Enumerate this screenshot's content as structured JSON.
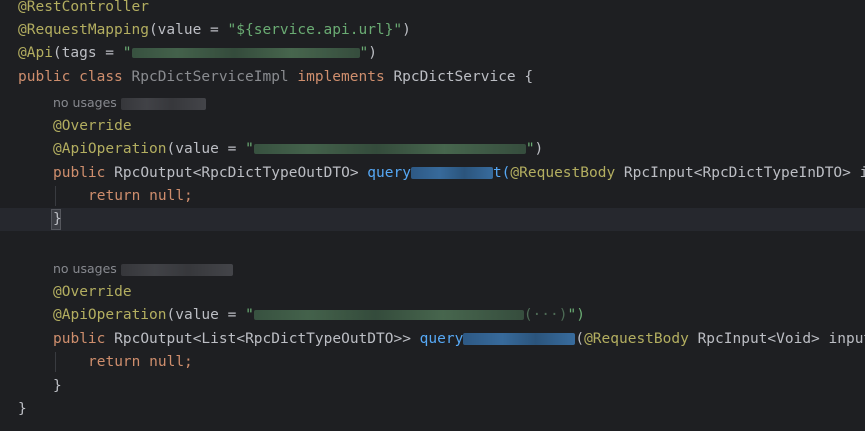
{
  "editor": {
    "tokens": {
      "rest_controller": "@RestController",
      "request_mapping": "@RequestMapping",
      "value_open": "(value = ",
      "service_url": "\"${service.api.url}\"",
      "close_paren": ")",
      "api": "@Api",
      "tags_open": "(tags = ",
      "quote": "\"",
      "quote_paren": "\")",
      "public": "public",
      "class": "class",
      "class_name": "RpcDictServiceImpl",
      "implements": "implements",
      "interface_name": "RpcDictService {",
      "no_usages": "no usages",
      "override": "@Override",
      "api_operation": "@ApiOperation",
      "return_type_1": "RpcOutput<RpcDictTypeOutDTO>",
      "method_prefix_1": "query",
      "method_suffix_1": "t(",
      "request_body": "@RequestBody",
      "param_1": "RpcInput<RpcDictTypeInDTO> in",
      "return": "return",
      "null_semi": "null;",
      "close_brace": "}",
      "return_type_2": "RpcOutput<List<RpcDictTypeOutDTO>>",
      "method_prefix_2": "query",
      "open_paren": "(",
      "param_2": "RpcInput<Void> input",
      "blur_paren": "(···)"
    }
  }
}
